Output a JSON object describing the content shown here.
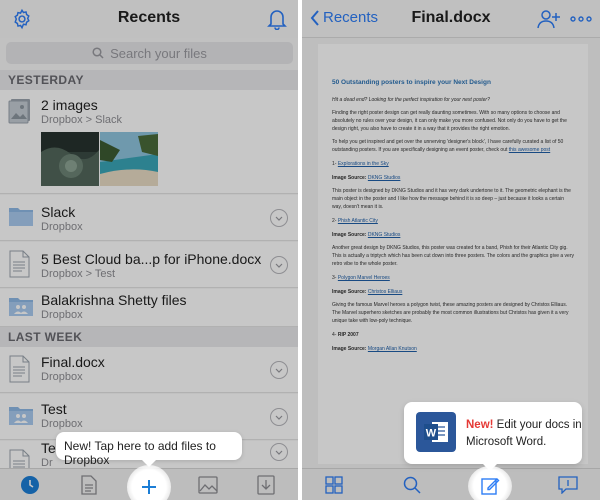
{
  "left": {
    "title": "Recents",
    "search_placeholder": "Search your files",
    "sections": {
      "yesterday": "YESTERDAY",
      "last_week": "LAST WEEK"
    },
    "items": [
      {
        "name": "2 images",
        "sub": "Dropbox > Slack",
        "icon": "image-stack-icon"
      },
      {
        "name": "Slack",
        "sub": "Dropbox",
        "icon": "folder-icon"
      },
      {
        "name": "5 Best Cloud ba...p for iPhone.docx",
        "sub": "Dropbox > Test",
        "icon": "document-icon"
      },
      {
        "name": "Balakrishna Shetty files",
        "sub": "Dropbox",
        "icon": "shared-folder-icon"
      },
      {
        "name": "Final.docx",
        "sub": "Dropbox",
        "icon": "document-icon"
      },
      {
        "name": "Test",
        "sub": "Dropbox",
        "icon": "shared-folder-icon"
      },
      {
        "name": "Te",
        "sub": "Dr",
        "icon": "document-icon"
      }
    ],
    "tooltip": "New! Tap here to add files to Dropbox",
    "accent": "#1c7ed6"
  },
  "right": {
    "back_label": "Recents",
    "title": "Final.docx",
    "tooltip": {
      "new": "New!",
      "text": " Edit your docs in Microsoft Word."
    },
    "doc": {
      "title": "50 Outstanding posters to inspire your Next Design",
      "intro": "Hit a dead end? Looking for the perfect inspiration for your next poster?",
      "para1": "Finding the right poster design can get really daunting sometimes. With so many options to choose and absolutely no rules over your design, it can only make you more confused. Not only do you have to get the design right, you also have to create it in a way that it provides the right emotion.",
      "para2a": "To help you get inspired and get over the unnerving 'designer's block', I have carefully curated a list of 50 outstanding posters. If you are specifically designing an event poster, check out ",
      "para2link": "this awesome post",
      "items": [
        {
          "num": "1-",
          "title": "Explorations in the Sky",
          "source_label": "Image Source: ",
          "source": "DKNG Studios",
          "desc": "This poster is designed by DKNG Studios and it has very dark undertone to it. The geometric elephant is the main object in the poster and I like how the message behind it is so deep – just because it looks a certain way, doesn't mean it is."
        },
        {
          "num": "2-",
          "title": "Phish Atlantic City",
          "source_label": "Image Source: ",
          "source": "DKNG Studios",
          "desc": "Another great design by DKNG Studios, this poster was created for a band, Phish for their Atlantic City gig. This is actually a triptych which has been cut down into three posters. The colors and the graphics give a very retro vibe to the whole poster."
        },
        {
          "num": "3-",
          "title": "Polygon Marvel Heroes",
          "source_label": "Image Source: ",
          "source": "Christos Elliaus",
          "desc": "Giving the famous Marvel heroes a polygon twist, these amazing posters are designed by Christos Elliaus. The Marvel superhero sketches are probably the most common illustrations but Christos has given it a very unique take with low-poly technique."
        },
        {
          "num": "4-",
          "title": "RIP 2007",
          "source_label": "Image Source: ",
          "source": "Morgan Allan Knutson",
          "desc": ""
        }
      ]
    }
  }
}
